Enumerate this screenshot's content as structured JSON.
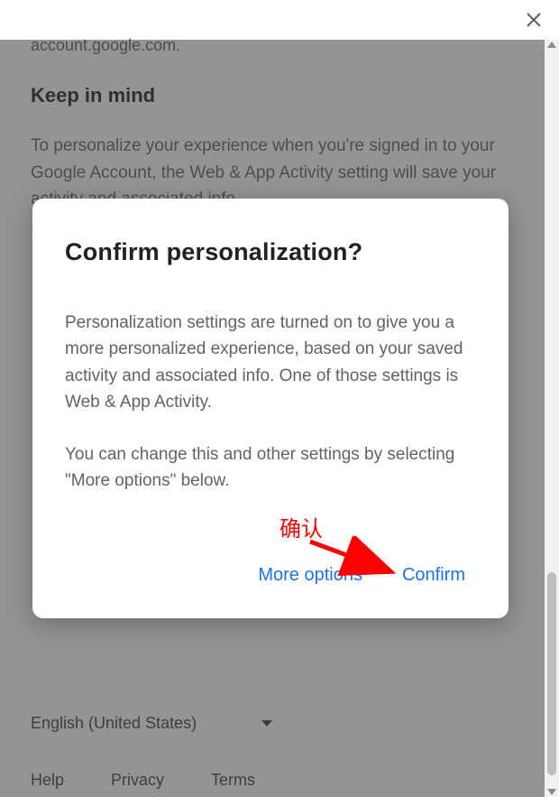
{
  "background": {
    "truncated": "account.google.com.",
    "heading": "Keep in mind",
    "paragraph": "To personalize your experience when you're signed in to your Google Account, the Web & App Activity setting will save your activity and associated info,"
  },
  "footer": {
    "language": "English (United States)",
    "links": {
      "help": "Help",
      "privacy": "Privacy",
      "terms": "Terms"
    }
  },
  "dialog": {
    "title": "Confirm personalization?",
    "p1": "Personalization settings are turned on to give you a more personalized experience, based on your saved activity and associated info. One of those settings is Web & App Activity.",
    "p2": "You can change this and other settings by selecting \"More options\" below.",
    "more_options": "More options",
    "confirm": "Confirm"
  },
  "annotation": {
    "label": "确认"
  },
  "colors": {
    "accent": "#1a73e8",
    "annotation": "#ff0000"
  }
}
